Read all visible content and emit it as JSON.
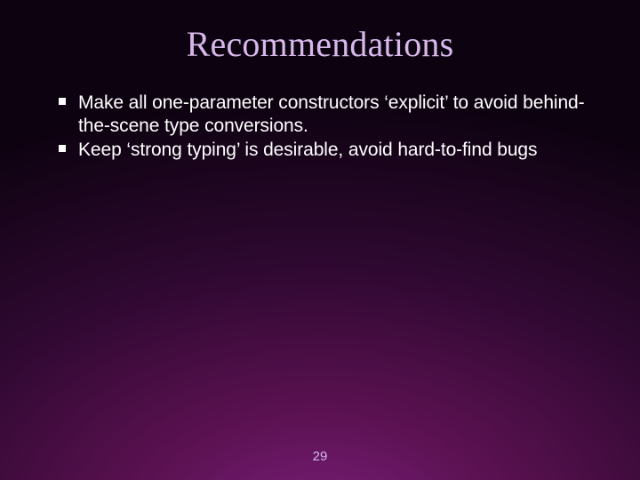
{
  "slide": {
    "title": "Recommendations",
    "bullets": [
      "Make all one-parameter constructors ‘explicit’ to avoid behind-the-scene type conversions.",
      "Keep ‘strong typing’ is desirable, avoid hard-to-find bugs"
    ],
    "page_number": "29"
  }
}
